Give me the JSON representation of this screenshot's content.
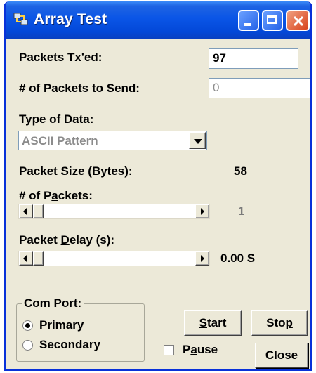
{
  "window": {
    "title": "Array Test",
    "icon": "network-icon"
  },
  "fields": {
    "packets_txed_label_pre": "Packets Tx'ed:",
    "packets_txed_value": "97",
    "packets_to_send_label_pre": "# of Pac",
    "packets_to_send_label_u": "k",
    "packets_to_send_label_post": "ets to Send:",
    "packets_to_send_value": "0",
    "type_label_u": "T",
    "type_label_post": "ype of Data:",
    "type_value": "ASCII Pattern",
    "packet_size_label": "Packet Size (Bytes):",
    "packet_size_value": "58",
    "num_packets_label_pre": "# of P",
    "num_packets_label_u": "a",
    "num_packets_label_post": "ckets:",
    "num_packets_value": "1",
    "num_packets_slider_level": 0.0,
    "delay_label_pre": "Packet ",
    "delay_label_u": "D",
    "delay_label_post": "elay (s):",
    "delay_value": "0.00 S",
    "delay_slider_level": 0.0
  },
  "com_port": {
    "label_pre": "Co",
    "label_u": "m",
    "label_post": " Port:",
    "options": [
      "Primary",
      "Secondary"
    ],
    "selected": "Primary"
  },
  "buttons": {
    "start_u": "S",
    "start_post": "tart",
    "stop_pre": "Sto",
    "stop_u": "p",
    "close_u": "C",
    "close_post": "lose"
  },
  "pause": {
    "label_pre": "P",
    "label_u": "a",
    "label_post": "use",
    "checked": false
  }
}
